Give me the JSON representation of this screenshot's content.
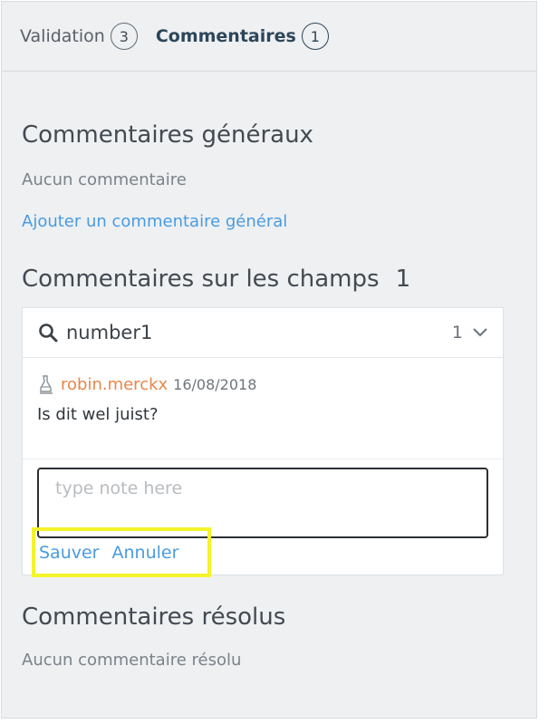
{
  "tabs": [
    {
      "label": "Validation",
      "count": "3"
    },
    {
      "label": "Commentaires",
      "count": "1"
    }
  ],
  "general": {
    "title": "Commentaires généraux",
    "empty": "Aucun commentaire",
    "add_link": "Ajouter un commentaire général"
  },
  "fields": {
    "title": "Commentaires sur les champs",
    "count": "1",
    "search": {
      "value": "number1",
      "count": "1"
    },
    "comment": {
      "author": "robin.merckx",
      "date": "16/08/2018",
      "text": "Is dit wel juist?"
    },
    "note": {
      "placeholder": "type note here"
    },
    "save_label": "Sauver",
    "cancel_label": "Annuler"
  },
  "resolved": {
    "title": "Commentaires résolus",
    "empty": "Aucun commentaire résolu"
  },
  "colors": {
    "link": "#4a9be0",
    "author": "#e8874a",
    "highlight": "#f4f42a"
  },
  "icons": [
    "search-icon",
    "chevron-down-icon",
    "user-icon"
  ]
}
